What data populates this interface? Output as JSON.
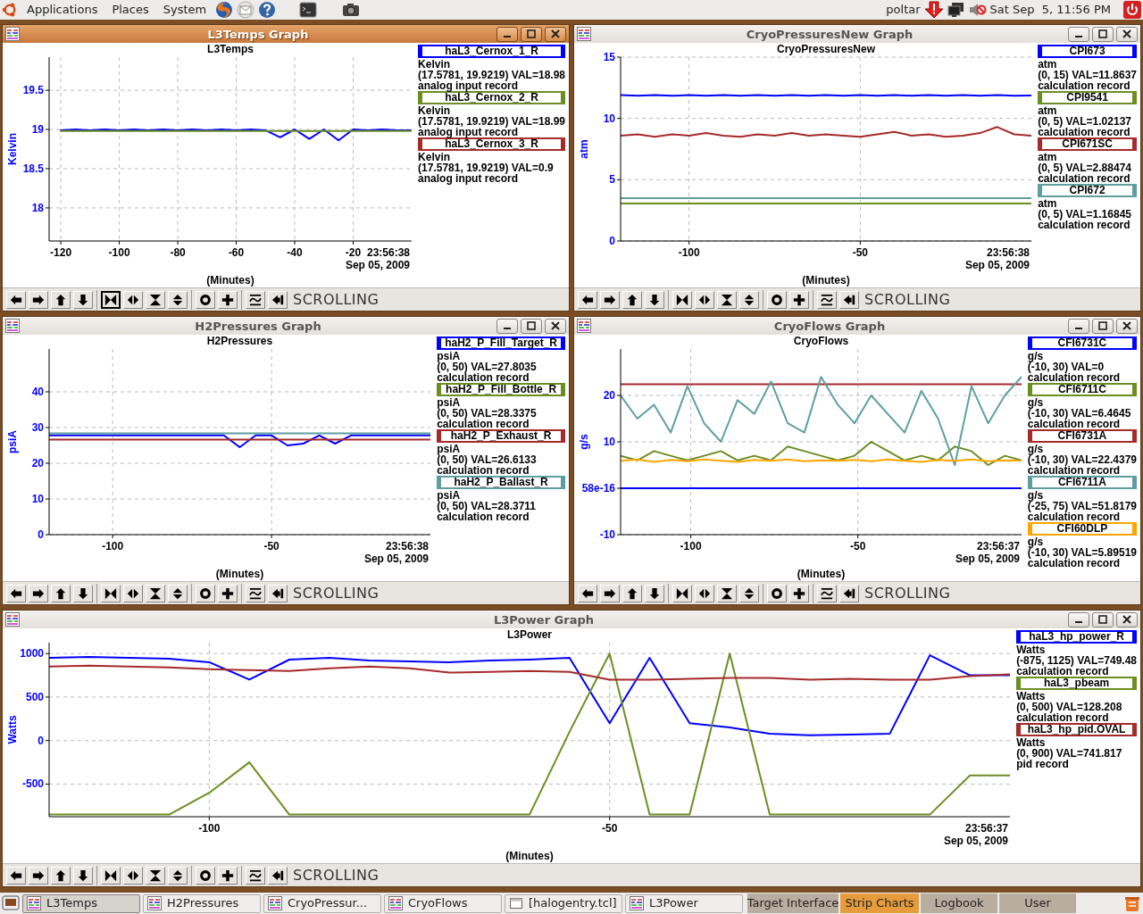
{
  "top_panel": {
    "menus": [
      "Applications",
      "Places",
      "System"
    ],
    "user": "poltar",
    "clock": "Sat Sep  5, 11:56 PM"
  },
  "windows": [
    {
      "title": "L3Temps Graph",
      "active": true,
      "timestamp": "23:56:38",
      "date": "Sep 05, 2009",
      "mode": "SCROLLING",
      "tools": [
        {
          "kind": "pan-left",
          "selected": false
        },
        {
          "kind": "pan-right",
          "selected": false
        },
        {
          "kind": "pan-up",
          "selected": false
        },
        {
          "kind": "pan-down",
          "selected": false
        },
        {
          "kind": "zoom-in-x",
          "selected": true
        },
        {
          "kind": "zoom-out-x",
          "selected": false
        },
        {
          "kind": "zoom-in-y",
          "selected": false
        },
        {
          "kind": "zoom-out-y",
          "selected": false
        },
        {
          "kind": "auto",
          "selected": false
        },
        {
          "kind": "add",
          "selected": false
        },
        {
          "kind": "graph",
          "selected": false
        },
        {
          "kind": "back",
          "selected": false
        }
      ],
      "legend": [
        {
          "units": "Kelvin",
          "range": "(17.5781, 19.9219) VAL=18.98",
          "record": "analog input record"
        },
        {
          "units": "Kelvin",
          "range": "(17.5781, 19.9219) VAL=18.99",
          "record": "analog input record"
        },
        {
          "units": "Kelvin",
          "range": "(17.5781, 19.9219) VAL=0.9",
          "record": "analog input record"
        }
      ],
      "chart_data": {
        "type": "line",
        "grid": true,
        "title": "L3Temps",
        "xlabel": "(Minutes)",
        "ylabel": "Kelvin",
        "x": [
          -120,
          -115,
          -110,
          -105,
          -100,
          -95,
          -90,
          -85,
          -80,
          -75,
          -70,
          -65,
          -60,
          -55,
          -50,
          -45,
          -40,
          -35,
          -30,
          -25,
          -20,
          -15,
          -10,
          -5,
          0
        ],
        "series": [
          {
            "name": "haL3_Cernox_1_R",
            "color": "#0000ff",
            "values": [
              18.99,
              19.0,
              18.99,
              19.0,
              18.99,
              19.0,
              18.99,
              19.0,
              18.99,
              19.0,
              18.99,
              19.0,
              18.99,
              19.0,
              18.99,
              18.9,
              19.0,
              18.88,
              19.0,
              18.86,
              19.0,
              18.99,
              19.0,
              18.99,
              18.99
            ]
          },
          {
            "name": "haL3_Cernox_2_R",
            "color": "#6b8e23",
            "values": [
              18.98,
              18.98,
              18.98,
              18.98,
              18.98,
              18.98,
              18.98,
              18.98,
              18.98,
              18.98,
              18.98,
              18.98,
              18.98,
              18.98,
              18.98,
              18.98,
              18.98,
              18.98,
              18.98,
              18.98,
              18.98,
              18.98,
              18.98,
              18.98,
              18.98
            ]
          },
          {
            "name": "haL3_Cernox_3_R",
            "color": "#a52a2a",
            "values": [
              null,
              null,
              null,
              null,
              null,
              null,
              null,
              null,
              null,
              null,
              null,
              null,
              null,
              null,
              null,
              null,
              null,
              null,
              null,
              null,
              null,
              null,
              null,
              null,
              null
            ]
          }
        ],
        "xlim": [
          -124,
          0
        ],
        "ylim": [
          17.5781,
          19.9219
        ],
        "xticks": [
          -120,
          -100,
          -80,
          -60,
          -40,
          -20
        ],
        "yticks": [
          18,
          18.5,
          19,
          19.5
        ]
      }
    },
    {
      "title": "CryoPressuresNew Graph",
      "active": false,
      "timestamp": "23:56:38",
      "date": "Sep 05, 2009",
      "mode": "SCROLLING",
      "tools": [
        {
          "kind": "pan-left",
          "selected": false
        },
        {
          "kind": "pan-right",
          "selected": false
        },
        {
          "kind": "pan-up",
          "selected": false
        },
        {
          "kind": "pan-down",
          "selected": false
        },
        {
          "kind": "zoom-in-x",
          "selected": false
        },
        {
          "kind": "zoom-out-x",
          "selected": false
        },
        {
          "kind": "zoom-in-y",
          "selected": false
        },
        {
          "kind": "zoom-out-y",
          "selected": false
        },
        {
          "kind": "auto",
          "selected": false
        },
        {
          "kind": "add",
          "selected": false
        },
        {
          "kind": "graph",
          "selected": false
        },
        {
          "kind": "back",
          "selected": false
        }
      ],
      "legend": [
        {
          "units": "atm",
          "range": "(0, 15) VAL=11.8637",
          "record": "calculation record"
        },
        {
          "units": "atm",
          "range": "(0, 5) VAL=1.02137",
          "record": "calculation record"
        },
        {
          "units": "atm",
          "range": "(0, 5) VAL=2.88474",
          "record": "calculation record"
        },
        {
          "units": "atm",
          "range": "(0, 5) VAL=1.16845",
          "record": "calculation record"
        }
      ],
      "chart_data": {
        "type": "line",
        "grid": true,
        "title": "CryoPressuresNew",
        "xlabel": "(Minutes)",
        "ylabel": "atm",
        "x": [
          -120,
          -115,
          -110,
          -105,
          -100,
          -95,
          -90,
          -85,
          -80,
          -75,
          -70,
          -65,
          -60,
          -55,
          -50,
          -45,
          -40,
          -35,
          -30,
          -25,
          -20,
          -15,
          -10,
          -5,
          0
        ],
        "series": [
          {
            "name": "CPI673",
            "color": "#0000ff",
            "values": [
              11.9,
              11.85,
              11.9,
              11.85,
              11.9,
              11.85,
              11.9,
              11.85,
              11.9,
              11.85,
              11.9,
              11.85,
              11.9,
              11.85,
              11.9,
              11.85,
              11.9,
              11.85,
              11.9,
              11.85,
              11.9,
              11.85,
              11.9,
              11.85,
              11.86
            ]
          },
          {
            "name": "CPI9541",
            "color": "#6b8e23",
            "values": [
              3.06,
              3.06,
              3.06,
              3.06,
              3.06,
              3.06,
              3.06,
              3.06,
              3.06,
              3.06,
              3.06,
              3.06,
              3.06,
              3.06,
              3.06,
              3.06,
              3.06,
              3.06,
              3.06,
              3.06,
              3.06,
              3.06,
              3.06,
              3.06,
              3.06
            ]
          },
          {
            "name": "CPI671SC",
            "color": "#a52a2a",
            "values": [
              8.6,
              8.7,
              8.5,
              8.7,
              8.6,
              8.8,
              8.6,
              8.5,
              8.7,
              8.6,
              8.8,
              8.6,
              8.7,
              8.6,
              8.5,
              8.7,
              8.9,
              8.6,
              8.7,
              8.5,
              8.6,
              8.8,
              9.3,
              8.7,
              8.6
            ]
          },
          {
            "name": "CPI672",
            "color": "#5f9ea0",
            "values": [
              3.5,
              3.5,
              3.5,
              3.5,
              3.5,
              3.5,
              3.5,
              3.5,
              3.5,
              3.5,
              3.5,
              3.5,
              3.5,
              3.5,
              3.5,
              3.5,
              3.5,
              3.5,
              3.5,
              3.5,
              3.5,
              3.5,
              3.5,
              3.5,
              3.5
            ]
          }
        ],
        "xlim": [
          -120,
          0
        ],
        "ylim": [
          0,
          15
        ],
        "xticks": [
          -100,
          -50
        ],
        "yticks": [
          0,
          5,
          10,
          15
        ]
      }
    },
    {
      "title": "H2Pressures Graph",
      "active": false,
      "timestamp": "23:56:38",
      "date": "Sep 05, 2009",
      "mode": "SCROLLING",
      "tools": [
        {
          "kind": "pan-left",
          "selected": false
        },
        {
          "kind": "pan-right",
          "selected": false
        },
        {
          "kind": "pan-up",
          "selected": false
        },
        {
          "kind": "pan-down",
          "selected": false
        },
        {
          "kind": "zoom-in-x",
          "selected": false
        },
        {
          "kind": "zoom-out-x",
          "selected": false
        },
        {
          "kind": "zoom-in-y",
          "selected": false
        },
        {
          "kind": "zoom-out-y",
          "selected": false
        },
        {
          "kind": "auto",
          "selected": false
        },
        {
          "kind": "add",
          "selected": false
        },
        {
          "kind": "graph",
          "selected": false
        },
        {
          "kind": "back",
          "selected": false
        }
      ],
      "legend": [
        {
          "units": "psiA",
          "range": "(0, 50) VAL=27.8035",
          "record": "calculation record"
        },
        {
          "units": "psiA",
          "range": "(0, 50) VAL=28.3375",
          "record": "calculation record"
        },
        {
          "units": "psiA",
          "range": "(0, 50) VAL=26.6133",
          "record": "calculation record"
        },
        {
          "units": "psiA",
          "range": "(0, 50) VAL=28.3711",
          "record": "calculation record"
        }
      ],
      "chart_data": {
        "type": "line",
        "grid": true,
        "title": "H2Pressures",
        "xlabel": "(Minutes)",
        "ylabel": "psiA",
        "x": [
          -120,
          -115,
          -110,
          -105,
          -100,
          -95,
          -90,
          -85,
          -80,
          -75,
          -70,
          -65,
          -60,
          -55,
          -50,
          -45,
          -40,
          -35,
          -30,
          -25,
          -20,
          -15,
          -10,
          -5,
          0
        ],
        "series": [
          {
            "name": "haH2_P_Fill_Target_R",
            "color": "#0000ff",
            "values": [
              27.8,
              27.8,
              27.8,
              27.8,
              27.8,
              27.8,
              27.8,
              27.8,
              27.8,
              27.8,
              27.8,
              27.8,
              24.5,
              27.8,
              27.8,
              25.0,
              25.5,
              27.8,
              25.5,
              27.8,
              27.8,
              27.8,
              27.8,
              27.8,
              27.8
            ]
          },
          {
            "name": "haH2_P_Fill_Bottle_R",
            "color": "#6b8e23",
            "values": [
              null,
              null,
              null,
              null,
              null,
              null,
              null,
              null,
              null,
              null,
              null,
              null,
              null,
              null,
              null,
              null,
              null,
              null,
              null,
              null,
              null,
              null,
              null,
              null,
              null
            ]
          },
          {
            "name": "haH2_P_Exhaust_R",
            "color": "#a52a2a",
            "values": [
              26.6,
              26.6,
              26.6,
              26.6,
              26.6,
              26.6,
              26.6,
              26.6,
              26.6,
              26.6,
              26.6,
              26.6,
              26.6,
              26.6,
              26.6,
              26.6,
              26.6,
              26.6,
              26.6,
              26.6,
              26.6,
              26.6,
              26.6,
              26.6,
              26.6
            ]
          },
          {
            "name": "haH2_P_Ballast_R",
            "color": "#5f9ea0",
            "values": [
              28.4,
              28.4,
              28.4,
              28.4,
              28.4,
              28.4,
              28.4,
              28.4,
              28.4,
              28.4,
              28.4,
              28.4,
              28.4,
              28.4,
              28.4,
              28.4,
              28.4,
              28.4,
              28.4,
              28.4,
              28.4,
              28.4,
              28.4,
              28.4,
              28.4
            ]
          }
        ],
        "xlim": [
          -120,
          0
        ],
        "ylim": [
          0,
          52
        ],
        "xticks": [
          -100,
          -50
        ],
        "yticks": [
          0,
          10,
          20,
          30,
          40
        ]
      }
    },
    {
      "title": "CryoFlows Graph",
      "active": false,
      "timestamp": "23:56:37",
      "date": "Sep 05, 2009",
      "mode": "SCROLLING",
      "tools": [
        {
          "kind": "pan-left",
          "selected": false
        },
        {
          "kind": "pan-right",
          "selected": false
        },
        {
          "kind": "pan-up",
          "selected": false
        },
        {
          "kind": "pan-down",
          "selected": false
        },
        {
          "kind": "zoom-in-x",
          "selected": false
        },
        {
          "kind": "zoom-out-x",
          "selected": false
        },
        {
          "kind": "zoom-in-y",
          "selected": false
        },
        {
          "kind": "zoom-out-y",
          "selected": false
        },
        {
          "kind": "auto",
          "selected": false
        },
        {
          "kind": "add",
          "selected": false
        },
        {
          "kind": "graph",
          "selected": false
        },
        {
          "kind": "back",
          "selected": false
        }
      ],
      "legend": [
        {
          "units": "g/s",
          "range": "(-10, 30) VAL=0",
          "record": "calculation record"
        },
        {
          "units": "g/s",
          "range": "(-10, 30) VAL=6.4645",
          "record": "calculation record"
        },
        {
          "units": "g/s",
          "range": "(-10, 30) VAL=22.4379",
          "record": "calculation record"
        },
        {
          "units": "g/s",
          "range": "(-25, 75) VAL=51.8179",
          "record": "calculation record"
        },
        {
          "units": "g/s",
          "range": "(-10, 30) VAL=5.89519",
          "record": "calculation record"
        }
      ],
      "chart_data": {
        "type": "line",
        "grid": true,
        "title": "CryoFlows",
        "xlabel": "(Minutes)",
        "ylabel": "g/s",
        "x": [
          -121,
          -116,
          -111,
          -106,
          -101,
          -96,
          -91,
          -86,
          -81,
          -76,
          -71,
          -66,
          -61,
          -56,
          -51,
          -46,
          -41,
          -36,
          -31,
          -26,
          -21,
          -16,
          -11,
          -6,
          -1
        ],
        "series": [
          {
            "name": "CFI6731C",
            "color": "#0000ff",
            "values": [
              0,
              0,
              0,
              0,
              0,
              0,
              0,
              0,
              0,
              0,
              0,
              0,
              0,
              0,
              0,
              0,
              0,
              0,
              0,
              0,
              0,
              0,
              0,
              0,
              0
            ]
          },
          {
            "name": "CFI6711C",
            "color": "#6b8e23",
            "values": [
              7,
              6,
              8,
              7,
              6,
              7,
              8,
              6,
              7,
              6,
              9,
              8,
              7,
              6,
              7,
              10,
              8,
              6,
              7,
              6,
              9,
              8,
              5,
              7,
              6
            ]
          },
          {
            "name": "CFI6731A",
            "color": "#a52a2a",
            "values": [
              22.4,
              22.4,
              22.4,
              22.4,
              22.4,
              22.4,
              22.4,
              22.4,
              22.4,
              22.4,
              22.4,
              22.4,
              22.4,
              22.4,
              22.4,
              22.4,
              22.4,
              22.4,
              22.4,
              22.4,
              22.4,
              22.4,
              22.4,
              22.4,
              22.4
            ]
          },
          {
            "name": "CFI6711A",
            "color": "#5f9ea0",
            "values": [
              20,
              15,
              18,
              12,
              22,
              14,
              10,
              19,
              16,
              23,
              14,
              12,
              24,
              18,
              14,
              20,
              16,
              12,
              21,
              15,
              5,
              22,
              14,
              20,
              24
            ]
          },
          {
            "name": "CFI60DLP",
            "color": "#ffa500",
            "values": [
              5.9,
              6.2,
              5.7,
              6.1,
              5.8,
              6.2,
              5.9,
              5.7,
              6.1,
              5.9,
              6.2,
              5.8,
              6.0,
              5.9,
              6.1,
              5.8,
              6.2,
              5.9,
              5.7,
              6.1,
              5.9,
              6.2,
              5.8,
              6.0,
              5.9
            ]
          }
        ],
        "xlim": [
          -121,
          -1
        ],
        "ylim": [
          -10,
          30
        ],
        "xticks": [
          -100,
          -50
        ],
        "yticks": [
          -10,
          {
            "value": 0,
            "label": "58e-16"
          },
          10,
          20
        ]
      }
    },
    {
      "title": "L3Power Graph",
      "active": false,
      "timestamp": "23:56:37",
      "date": "Sep 05, 2009",
      "mode": "SCROLLING",
      "tools": [
        {
          "kind": "pan-left",
          "selected": false
        },
        {
          "kind": "pan-right",
          "selected": false
        },
        {
          "kind": "pan-up",
          "selected": false
        },
        {
          "kind": "pan-down",
          "selected": false
        },
        {
          "kind": "zoom-in-x",
          "selected": false
        },
        {
          "kind": "zoom-out-x",
          "selected": false
        },
        {
          "kind": "zoom-in-y",
          "selected": false
        },
        {
          "kind": "zoom-out-y",
          "selected": false
        },
        {
          "kind": "auto",
          "selected": false
        },
        {
          "kind": "add",
          "selected": false
        },
        {
          "kind": "graph",
          "selected": false
        },
        {
          "kind": "back",
          "selected": false
        }
      ],
      "legend": [
        {
          "units": "Watts",
          "range": "(-875, 1125) VAL=749.48",
          "record": "calculation record"
        },
        {
          "units": "Watts",
          "range": "(0, 500) VAL=128.208",
          "record": "calculation record"
        },
        {
          "units": "Watts",
          "range": "(0, 900) VAL=741.817",
          "record": "pid record"
        }
      ],
      "chart_data": {
        "type": "line",
        "grid": true,
        "title": "L3Power",
        "xlabel": "(Minutes)",
        "ylabel": "Watts",
        "x": [
          -120,
          -115,
          -110,
          -105,
          -100,
          -95,
          -90,
          -85,
          -80,
          -75,
          -70,
          -65,
          -60,
          -55,
          -50,
          -45,
          -40,
          -35,
          -30,
          -25,
          -20,
          -15,
          -10,
          -5,
          0
        ],
        "series": [
          {
            "name": "haL3_hp_power_R",
            "color": "#0000ff",
            "values": [
              950,
              960,
              950,
              940,
              900,
              700,
              930,
              950,
              920,
              910,
              900,
              920,
              930,
              950,
              200,
              950,
              200,
              150,
              80,
              60,
              70,
              80,
              980,
              750,
              750
            ]
          },
          {
            "name": "haL3_pbeam",
            "color": "#6b8e23",
            "values": [
              -850,
              -850,
              -850,
              -850,
              -600,
              -250,
              -850,
              -850,
              -850,
              -850,
              -850,
              -850,
              -850,
              100,
              1000,
              -850,
              -850,
              1000,
              -850,
              -850,
              -850,
              -850,
              -850,
              -400,
              -400
            ]
          },
          {
            "name": "haL3_hp_pid.OVAL",
            "color": "#a52a2a",
            "values": [
              850,
              860,
              850,
              840,
              820,
              810,
              800,
              830,
              850,
              830,
              780,
              790,
              800,
              790,
              700,
              700,
              710,
              720,
              720,
              700,
              710,
              700,
              700,
              740,
              760
            ]
          }
        ],
        "xlim": [
          -120,
          0
        ],
        "ylim": [
          -875,
          1125
        ],
        "xticks": [
          -100,
          -50
        ],
        "yticks": [
          -500,
          0,
          500,
          1000
        ]
      }
    }
  ],
  "taskbar": {
    "tasks": [
      {
        "label": "L3Temps",
        "kind": "chart",
        "selected": true
      },
      {
        "label": "H2Pressures",
        "kind": "chart",
        "selected": false
      },
      {
        "label": "CryoPressur...",
        "kind": "chart",
        "selected": false
      },
      {
        "label": "CryoFlows",
        "kind": "chart",
        "selected": false
      },
      {
        "label": "[halogentry.tcl]",
        "kind": "window",
        "selected": false
      },
      {
        "label": "L3Power",
        "kind": "chart",
        "selected": false
      }
    ],
    "tabs": [
      {
        "label": "Target Interface",
        "selected": false
      },
      {
        "label": "Strip Charts",
        "selected": true
      },
      {
        "label": "Logbook",
        "selected": false
      },
      {
        "label": "User",
        "selected": false
      }
    ]
  }
}
